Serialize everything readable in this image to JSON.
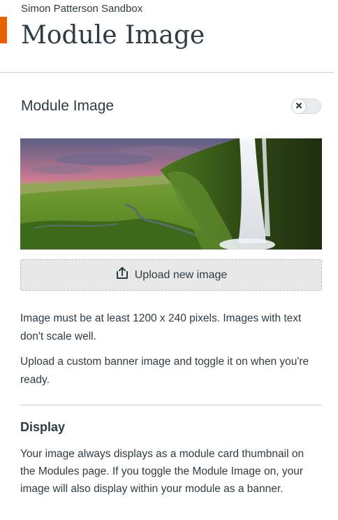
{
  "header": {
    "course_name": "Simon Patterson Sandbox",
    "page_title": "Module Image",
    "accent_color": "#e66000"
  },
  "module_image": {
    "section_title": "Module Image",
    "toggle": {
      "state": "off",
      "icon": "x-icon"
    },
    "banner": {
      "content": "waterfall-landscape-photo"
    },
    "upload_button": {
      "icon": "upload-icon",
      "label": "Upload new image"
    },
    "help_text_1": "Image must be at least 1200 x 240 pixels. Images with text don't scale well.",
    "help_text_2": "Upload a custom banner image and toggle it on when you're ready."
  },
  "display": {
    "heading": "Display",
    "description": "Your image always displays as a module card thumbnail on the Modules page. If you toggle the Module Image on, your image will also display within your module as a banner."
  }
}
